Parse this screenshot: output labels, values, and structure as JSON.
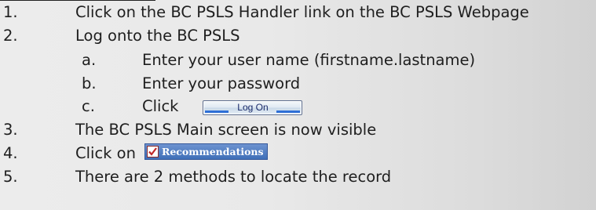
{
  "steps": [
    {
      "num": "1.",
      "text": "Click on the BC PSLS Handler link on the BC PSLS Webpage"
    },
    {
      "num": "2.",
      "text": "Log onto the BC PSLS"
    },
    {
      "num": "a.",
      "text": "Enter your user name (firstname.lastname)"
    },
    {
      "num": "b.",
      "text": "Enter your password"
    },
    {
      "num": "c.",
      "text": "Click"
    },
    {
      "num": "3.",
      "text": "The BC PSLS Main screen is now visible"
    },
    {
      "num": "4.",
      "text": "Click on"
    },
    {
      "num": "5.",
      "text": "There are 2 methods to locate the record"
    }
  ],
  "logon_button": {
    "label": "Log On"
  },
  "recommendations_button": {
    "label": "Recommendations",
    "icon": "checkbox-icon"
  },
  "colors": {
    "button_blue": "#3f6fb8",
    "check_red": "#c0282a"
  }
}
